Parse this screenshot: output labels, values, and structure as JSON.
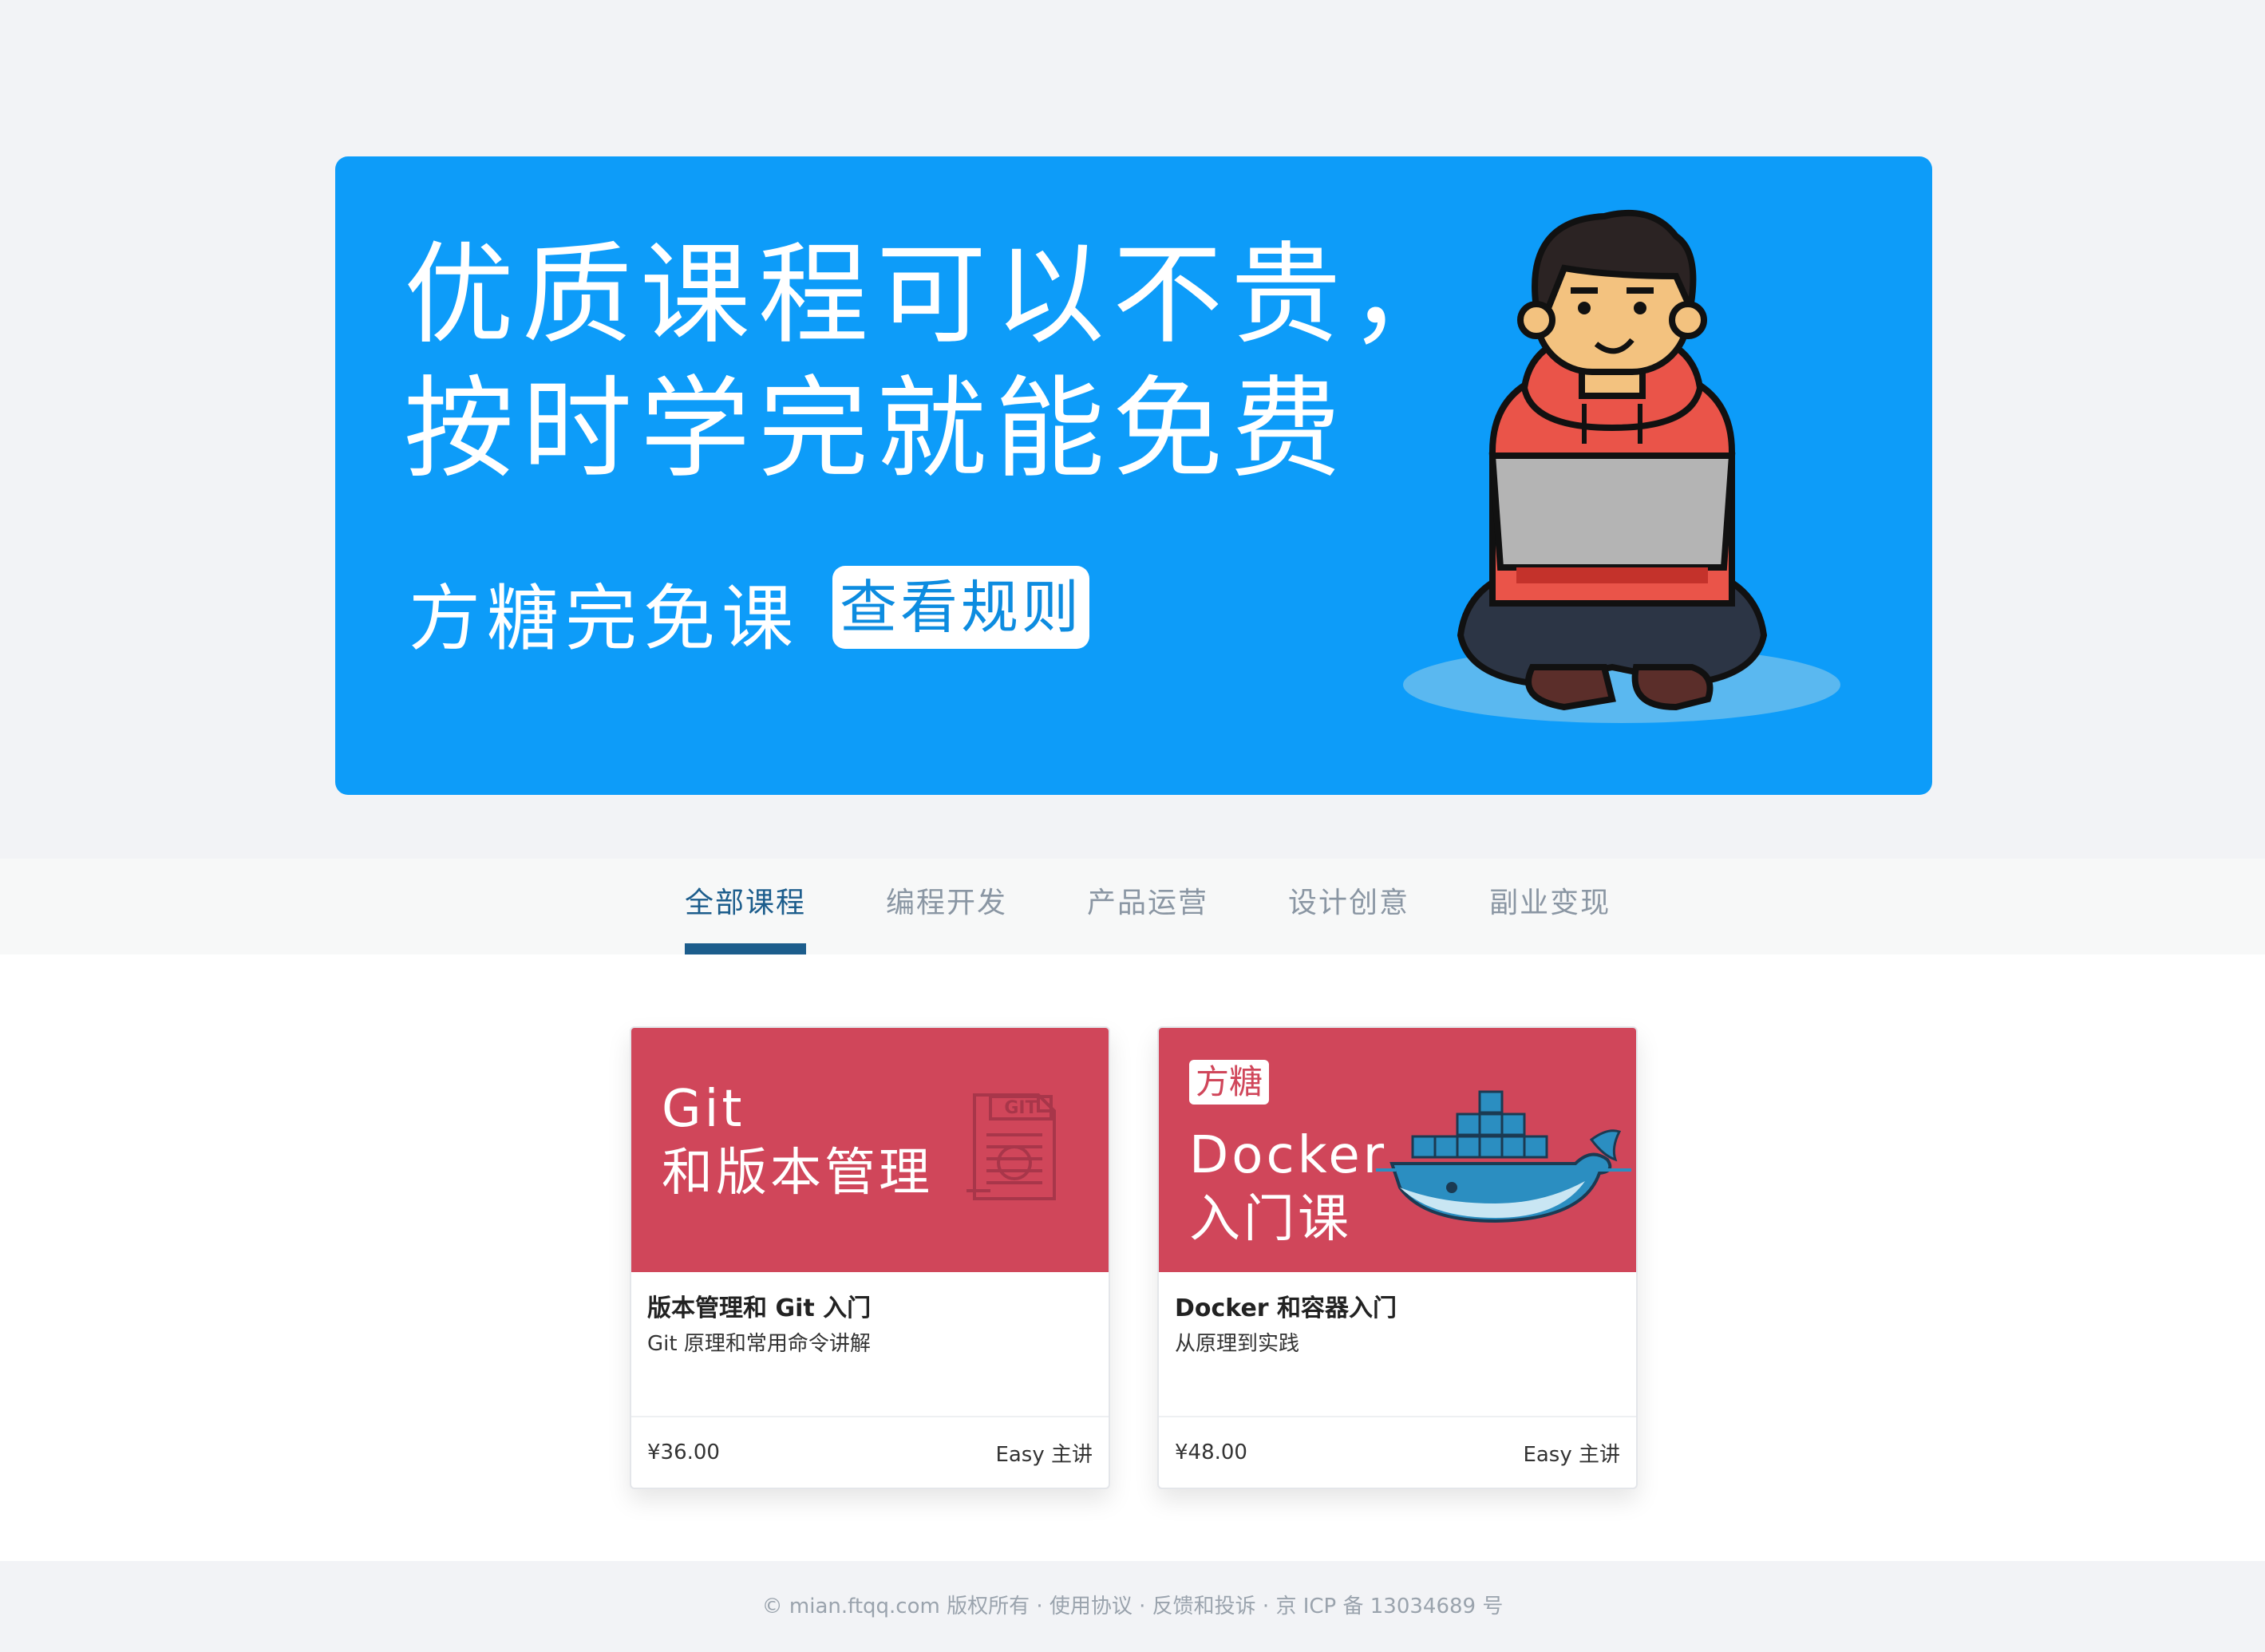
{
  "hero": {
    "headline_line1": "优质课程可以不贵，",
    "headline_line2": "按时学完就能免费",
    "subtitle": "方糖完免课",
    "rule_button": "查看规则",
    "background_color": "#0d9cf9"
  },
  "tabs": [
    {
      "label": "全部课程",
      "active": true
    },
    {
      "label": "编程开发",
      "active": false
    },
    {
      "label": "产品运营",
      "active": false
    },
    {
      "label": "设计创意",
      "active": false
    },
    {
      "label": "副业变现",
      "active": false
    }
  ],
  "courses": [
    {
      "cover_line1": "Git",
      "cover_line2": "和版本管理",
      "cover_icon": "git-file-icon",
      "title": "版本管理和 Git 入门",
      "desc": "Git 原理和常用命令讲解",
      "price": "¥36.00",
      "teacher": "Easy 主讲",
      "cover_color": "#d0465a"
    },
    {
      "brand_tag": "方糖",
      "cover_line1": "Docker",
      "cover_line2": "入门课",
      "cover_icon": "docker-whale-icon",
      "title": "Docker 和容器入门",
      "desc": "从原理到实践",
      "price": "¥48.00",
      "teacher": "Easy 主讲",
      "cover_color": "#d0465a"
    }
  ],
  "footer": {
    "text": "© mian.ftqq.com 版权所有 · 使用协议 · 反馈和投诉 · 京 ICP 备 13034689 号"
  }
}
